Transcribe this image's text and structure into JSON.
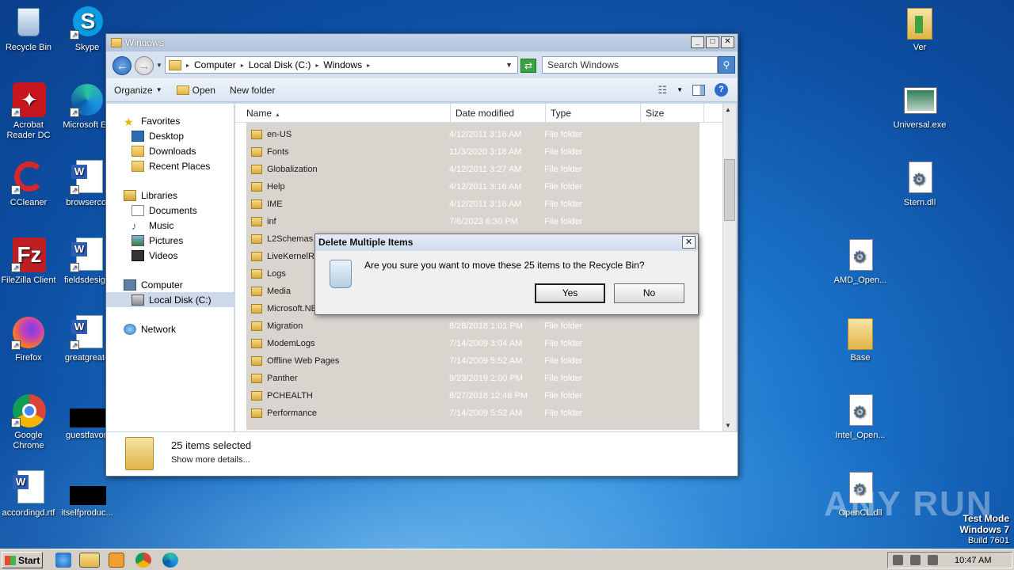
{
  "desktop_icons_left": [
    {
      "label": "Recycle Bin",
      "kind": "recycle"
    },
    {
      "label": "Skype",
      "kind": "skype"
    },
    {
      "label": "Acrobat Reader DC",
      "kind": "acrobat"
    },
    {
      "label": "Microsoft Ed",
      "kind": "edge"
    },
    {
      "label": "CCleaner",
      "kind": "ccleaner"
    },
    {
      "label": "browsercol",
      "kind": "word"
    },
    {
      "label": "FileZilla Client",
      "kind": "filezilla"
    },
    {
      "label": "fieldsdesign",
      "kind": "word"
    },
    {
      "label": "Firefox",
      "kind": "firefox"
    },
    {
      "label": "greatgreate",
      "kind": "word"
    },
    {
      "label": "Google Chrome",
      "kind": "chrome"
    },
    {
      "label": "guestfavori",
      "kind": "black"
    },
    {
      "label": "accordingd.rtf",
      "kind": "word"
    },
    {
      "label": "itselfproduc...",
      "kind": "black"
    }
  ],
  "desktop_icons_right": [
    {
      "label": "Ver",
      "kind": "folder"
    },
    {
      "label": "Universal.exe",
      "kind": "exe"
    },
    {
      "label": "Stern.dll",
      "kind": "dll"
    },
    {
      "label": "AMD_Open...",
      "kind": "dll"
    },
    {
      "label": "Base",
      "kind": "folder"
    },
    {
      "label": "Intel_Open...",
      "kind": "dll"
    },
    {
      "label": "OpenCL.dll",
      "kind": "dll"
    }
  ],
  "explorer": {
    "title": "Windows",
    "breadcrumb": [
      "Computer",
      "Local Disk (C:)",
      "Windows"
    ],
    "search_placeholder": "Search Windows",
    "toolbar": {
      "organize": "Organize",
      "open": "Open",
      "new_folder": "New folder"
    },
    "nav": {
      "favorites": "Favorites",
      "desktop": "Desktop",
      "downloads": "Downloads",
      "recent": "Recent Places",
      "libraries": "Libraries",
      "documents": "Documents",
      "music": "Music",
      "pictures": "Pictures",
      "videos": "Videos",
      "computer": "Computer",
      "local_disk": "Local Disk (C:)",
      "network": "Network"
    },
    "columns": {
      "name": "Name",
      "date": "Date modified",
      "type": "Type",
      "size": "Size"
    },
    "rows": [
      {
        "name": "en-US",
        "date": "4/12/2011 3:16 AM",
        "type": "File folder"
      },
      {
        "name": "Fonts",
        "date": "11/3/2020 3:18 AM",
        "type": "File folder"
      },
      {
        "name": "Globalization",
        "date": "4/12/2011 3:27 AM",
        "type": "File folder"
      },
      {
        "name": "Help",
        "date": "4/12/2011 3:16 AM",
        "type": "File folder"
      },
      {
        "name": "IME",
        "date": "4/12/2011 3:16 AM",
        "type": "File folder"
      },
      {
        "name": "inf",
        "date": "7/6/2023 6:30 PM",
        "type": "File folder"
      },
      {
        "name": "L2Schemas",
        "date": "",
        "type": ""
      },
      {
        "name": "LiveKernelRep",
        "date": "",
        "type": ""
      },
      {
        "name": "Logs",
        "date": "",
        "type": ""
      },
      {
        "name": "Media",
        "date": "",
        "type": ""
      },
      {
        "name": "Microsoft.NET",
        "date": "",
        "type": ""
      },
      {
        "name": "Migration",
        "date": "8/28/2018 1:01 PM",
        "type": "File folder"
      },
      {
        "name": "ModemLogs",
        "date": "7/14/2009 3:04 AM",
        "type": "File folder"
      },
      {
        "name": "Offline Web Pages",
        "date": "7/14/2009 5:52 AM",
        "type": "File folder"
      },
      {
        "name": "Panther",
        "date": "9/23/2019 2:00 PM",
        "type": "File folder"
      },
      {
        "name": "PCHEALTH",
        "date": "8/27/2018 12:48 PM",
        "type": "File folder"
      },
      {
        "name": "Performance",
        "date": "7/14/2009 5:52 AM",
        "type": "File folder"
      }
    ],
    "details": {
      "count": "25 items selected",
      "more": "Show more details..."
    }
  },
  "dialog": {
    "title": "Delete Multiple Items",
    "message": "Are you sure you want to move these 25 items to the Recycle Bin?",
    "yes": "Yes",
    "no": "No"
  },
  "taskbar": {
    "start": "Start",
    "clock": "10:47 AM"
  },
  "watermark": "ANY RUN",
  "testmode": {
    "line1": "Test Mode",
    "line2": "Windows 7",
    "line3": "Build 7601"
  }
}
